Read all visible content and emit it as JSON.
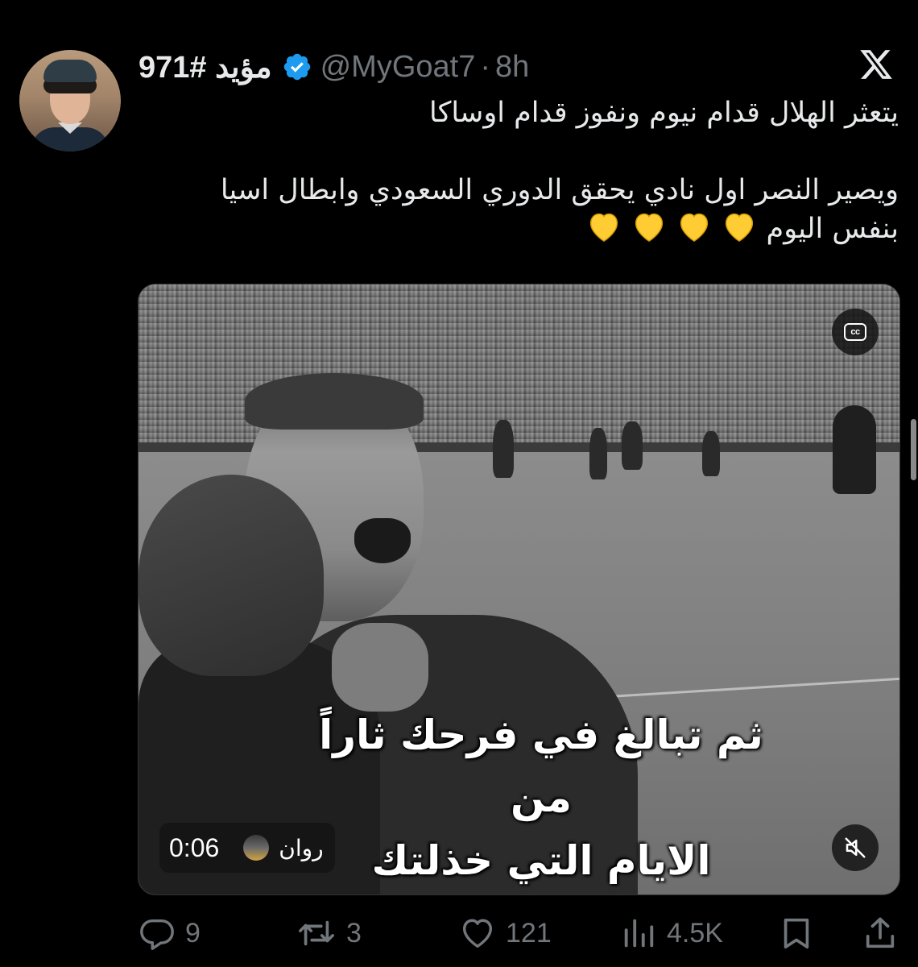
{
  "tweet": {
    "display_name": "مؤيد #971",
    "handle": "@MyGoat7",
    "separator": "·",
    "time": "8h",
    "lines": {
      "line1": "يتعثر الهلال قدام نيوم ونفوز قدام اوساكا",
      "line2": "ويصير النصر اول نادي يحقق الدوري السعودي وابطال اسيا",
      "line3": "بنفس اليوم"
    },
    "emoji": "yellow-heart x4"
  },
  "video": {
    "caption_line1": "ثم تبالغ في فرحك ثاراً من",
    "caption_line2": "الايام التي خذلتك",
    "cc_label": "cc",
    "uploader": "روان",
    "duration": "0:06"
  },
  "actions": {
    "replies": "9",
    "reposts": "3",
    "likes": "121",
    "views": "4.5K"
  },
  "colors": {
    "background": "#000000",
    "text": "#e7e9ea",
    "muted": "#71767b",
    "verified": "#1d9bf0",
    "heart": "#ffcc33"
  }
}
